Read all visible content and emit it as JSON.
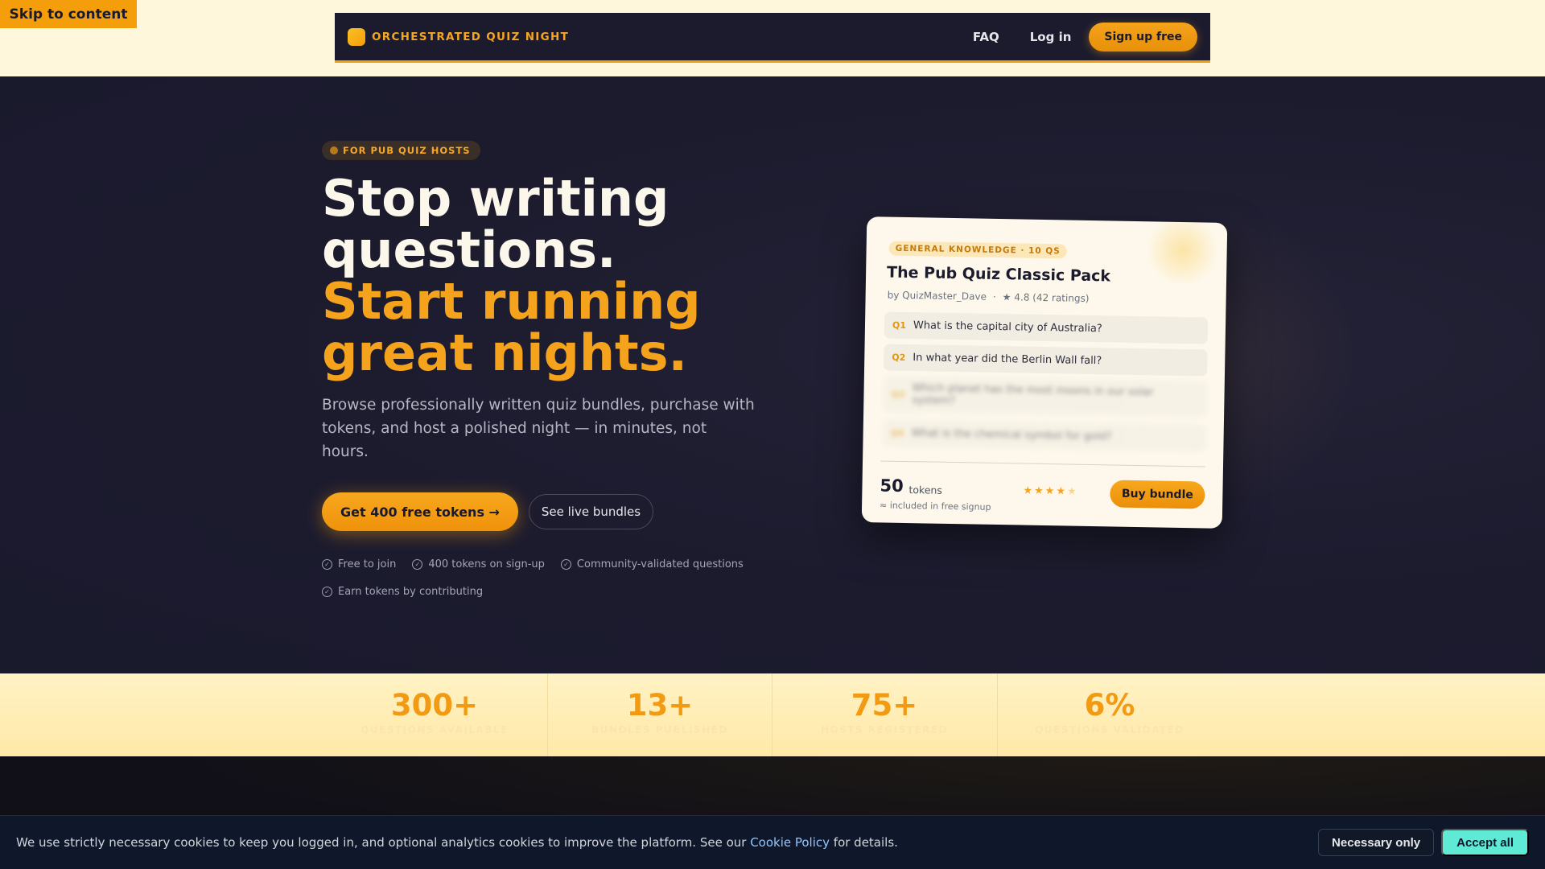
{
  "skip_link": "Skip to content",
  "nav": {
    "brand": "ORCHESTRATED QUIZ NIGHT",
    "faq": "FAQ",
    "login": "Log in",
    "signup": "Sign up free"
  },
  "hero": {
    "badge": "FOR PUB QUIZ HOSTS",
    "headline_line1": "Stop writing",
    "headline_line2": "questions.",
    "headline_accent1": "Start running",
    "headline_accent2": "great nights.",
    "subtext": "Browse professionally written quiz bundles, purchase with tokens, and host a polished night — in minutes, not hours.",
    "cta_primary": "Get 400 free tokens →",
    "cta_secondary": "See live bundles",
    "features": [
      "Free to join",
      "400 tokens on sign-up",
      "Community-validated questions",
      "Earn tokens by contributing"
    ]
  },
  "card": {
    "tag": "GENERAL KNOWLEDGE · 10 QS",
    "title": "The Pub Quiz Classic Pack",
    "author": "by QuizMaster_Dave",
    "separator": "·",
    "rating": "★ 4.8 (42 ratings)",
    "questions": [
      {
        "num": "Q1",
        "text": "What is the capital city of Australia?"
      },
      {
        "num": "Q2",
        "text": "In what year did the Berlin Wall fall?"
      },
      {
        "num": "Q3",
        "text": "Which planet has the most moons in our solar system?"
      },
      {
        "num": "Q4",
        "text": "What is the chemical symbol for gold?"
      }
    ],
    "price": "50",
    "price_unit": "tokens",
    "price_note": "≈ included in free signup",
    "stars_filled": "★★★★",
    "stars_empty": "★",
    "buy": "Buy bundle"
  },
  "stats": [
    {
      "value": "300+",
      "label": "QUESTIONS AVAILABLE"
    },
    {
      "value": "13+",
      "label": "BUNDLES PUBLISHED"
    },
    {
      "value": "75+",
      "label": "HOSTS REGISTERED"
    },
    {
      "value": "6%",
      "label": "QUESTIONS VALIDATED"
    }
  ],
  "cookie": {
    "text_before": "We use strictly necessary cookies to keep you logged in, and optional analytics cookies to improve the platform. See our ",
    "link": "Cookie Policy",
    "text_after": " for details.",
    "necessary": "Necessary only",
    "accept": "Accept all"
  },
  "colors": {
    "accent": "#f5a31c",
    "hero_bg": "#1c1b2e",
    "cookie_accept": "#5eead4"
  }
}
